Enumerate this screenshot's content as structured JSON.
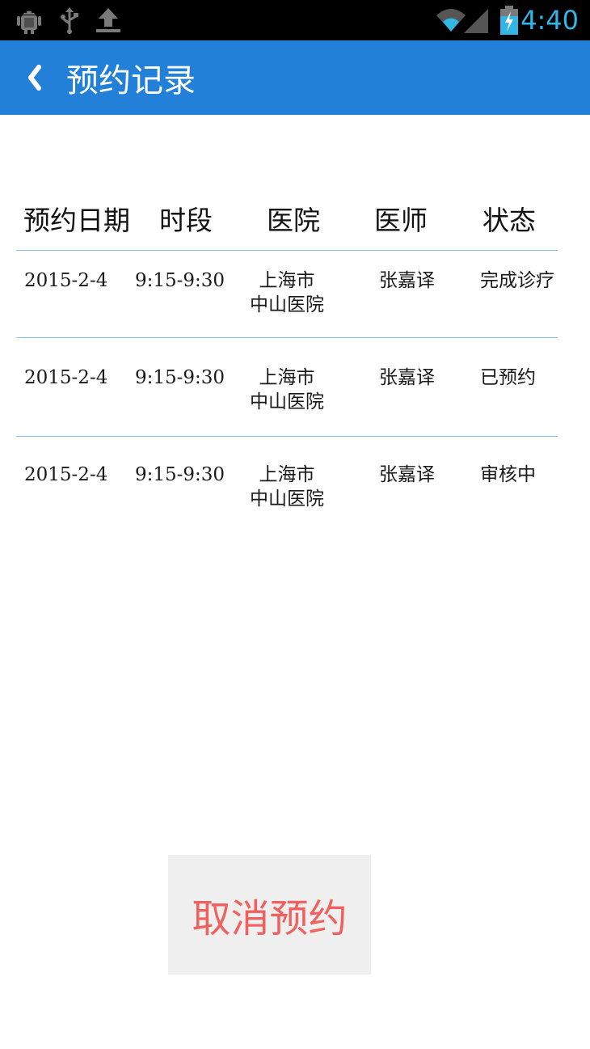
{
  "status_bar": {
    "time": "4:40",
    "icons": [
      "android-debug-icon",
      "usb-icon",
      "upload-icon",
      "wifi-icon",
      "signal-icon",
      "battery-charging-icon"
    ],
    "accent_color": "#33b5e5"
  },
  "header": {
    "back_icon": "chevron-left-icon",
    "title": "预约记录",
    "color": "#2380d8"
  },
  "table": {
    "columns": [
      "预约日期",
      "时段",
      "医院",
      "医师",
      "状态"
    ],
    "rows": [
      {
        "date": "2015-2-4",
        "time": "9:15-9:30",
        "hospital_line1": "上海市",
        "hospital_line2": "中山医院",
        "doctor": "张嘉译",
        "status": "完成诊疗"
      },
      {
        "date": "2015-2-4",
        "time": "9:15-9:30",
        "hospital_line1": "上海市",
        "hospital_line2": "中山医院",
        "doctor": "张嘉译",
        "status": "已预约"
      },
      {
        "date": "2015-2-4",
        "time": "9:15-9:30",
        "hospital_line1": "上海市",
        "hospital_line2": "中山医院",
        "doctor": "张嘉译",
        "status": "审核中"
      }
    ]
  },
  "actions": {
    "cancel_label": "取消预约",
    "cancel_color": "#f0605e"
  }
}
